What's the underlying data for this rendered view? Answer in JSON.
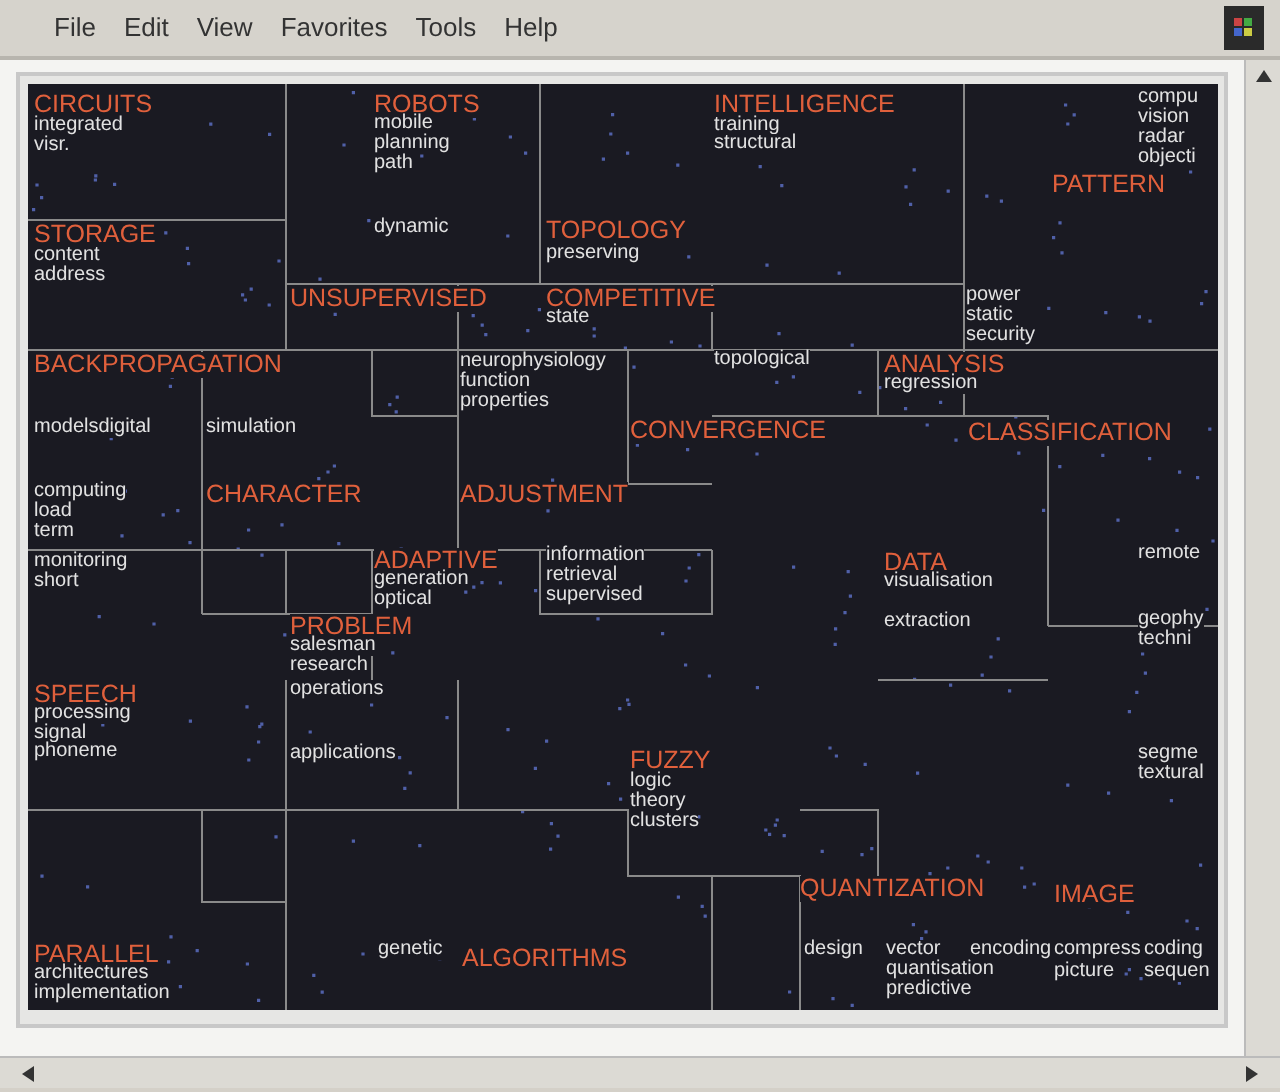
{
  "menu": [
    "File",
    "Edit",
    "View",
    "Favorites",
    "Tools",
    "Help"
  ],
  "map": {
    "labels": [
      {
        "text": "CIRCUITS",
        "kind": "topic"
      },
      {
        "text": "integrated",
        "kind": "word"
      },
      {
        "text": "visr.",
        "kind": "word"
      },
      {
        "text": "ROBOTS",
        "kind": "topic"
      },
      {
        "text": "mobile",
        "kind": "word"
      },
      {
        "text": "planning",
        "kind": "word"
      },
      {
        "text": "path",
        "kind": "word"
      },
      {
        "text": "INTELLIGENCE",
        "kind": "topic"
      },
      {
        "text": "training",
        "kind": "word"
      },
      {
        "text": "structural",
        "kind": "word"
      },
      {
        "text": "compu",
        "kind": "word"
      },
      {
        "text": "vision",
        "kind": "word"
      },
      {
        "text": "radar",
        "kind": "word"
      },
      {
        "text": "objecti",
        "kind": "word"
      },
      {
        "text": "PATTERN",
        "kind": "topic"
      },
      {
        "text": "STORAGE",
        "kind": "topic"
      },
      {
        "text": "content",
        "kind": "word"
      },
      {
        "text": "address",
        "kind": "word"
      },
      {
        "text": "dynamic",
        "kind": "word"
      },
      {
        "text": "TOPOLOGY",
        "kind": "topic"
      },
      {
        "text": "preserving",
        "kind": "word"
      },
      {
        "text": "UNSUPERVISED",
        "kind": "topic"
      },
      {
        "text": "COMPETITIVE",
        "kind": "topic"
      },
      {
        "text": "state",
        "kind": "word"
      },
      {
        "text": "power",
        "kind": "word"
      },
      {
        "text": "static",
        "kind": "word"
      },
      {
        "text": "security",
        "kind": "word"
      },
      {
        "text": "BACKPROPAGATION",
        "kind": "topic"
      },
      {
        "text": "neurophysiology",
        "kind": "word"
      },
      {
        "text": "function",
        "kind": "word"
      },
      {
        "text": "properties",
        "kind": "word"
      },
      {
        "text": "topological",
        "kind": "word"
      },
      {
        "text": "ANALYSIS",
        "kind": "topic"
      },
      {
        "text": "regression",
        "kind": "word"
      },
      {
        "text": "modelsdigital",
        "kind": "word"
      },
      {
        "text": "simulation",
        "kind": "word"
      },
      {
        "text": "CONVERGENCE",
        "kind": "topic"
      },
      {
        "text": "CLASSIFICATION",
        "kind": "topic"
      },
      {
        "text": "computing",
        "kind": "word"
      },
      {
        "text": "load",
        "kind": "word"
      },
      {
        "text": "term",
        "kind": "word"
      },
      {
        "text": "CHARACTER",
        "kind": "topic"
      },
      {
        "text": "ADJUSTMENT",
        "kind": "topic"
      },
      {
        "text": "remote",
        "kind": "word"
      },
      {
        "text": "monitoring",
        "kind": "word"
      },
      {
        "text": "short",
        "kind": "word"
      },
      {
        "text": "ADAPTIVE",
        "kind": "topic"
      },
      {
        "text": "generation",
        "kind": "word"
      },
      {
        "text": "optical",
        "kind": "word"
      },
      {
        "text": "information",
        "kind": "word"
      },
      {
        "text": "retrieval",
        "kind": "word"
      },
      {
        "text": "supervised",
        "kind": "word"
      },
      {
        "text": "DATA",
        "kind": "topic"
      },
      {
        "text": "visualisation",
        "kind": "word"
      },
      {
        "text": "extraction",
        "kind": "word"
      },
      {
        "text": "geophy",
        "kind": "word"
      },
      {
        "text": "techni",
        "kind": "word"
      },
      {
        "text": "PROBLEM",
        "kind": "topic"
      },
      {
        "text": "salesman",
        "kind": "word"
      },
      {
        "text": "research",
        "kind": "word"
      },
      {
        "text": "operations",
        "kind": "word"
      },
      {
        "text": "SPEECH",
        "kind": "topic"
      },
      {
        "text": "processing",
        "kind": "word"
      },
      {
        "text": "signal",
        "kind": "word"
      },
      {
        "text": "phoneme",
        "kind": "word"
      },
      {
        "text": "applications",
        "kind": "word"
      },
      {
        "text": "segme",
        "kind": "word"
      },
      {
        "text": "textural",
        "kind": "word"
      },
      {
        "text": "FUZZY",
        "kind": "topic"
      },
      {
        "text": "logic",
        "kind": "word"
      },
      {
        "text": "theory",
        "kind": "word"
      },
      {
        "text": "clusters",
        "kind": "word"
      },
      {
        "text": "QUANTIZATION",
        "kind": "topic"
      },
      {
        "text": "IMAGE",
        "kind": "topic"
      },
      {
        "text": "PARALLEL",
        "kind": "topic"
      },
      {
        "text": "architectures",
        "kind": "word"
      },
      {
        "text": "implementation",
        "kind": "word"
      },
      {
        "text": "genetic",
        "kind": "word"
      },
      {
        "text": "ALGORITHMS",
        "kind": "topic"
      },
      {
        "text": "design",
        "kind": "word"
      },
      {
        "text": "vector",
        "kind": "word"
      },
      {
        "text": "quantisation",
        "kind": "word"
      },
      {
        "text": "predictive",
        "kind": "word"
      },
      {
        "text": "encoding",
        "kind": "word"
      },
      {
        "text": "compress",
        "kind": "word"
      },
      {
        "text": "coding",
        "kind": "word"
      },
      {
        "text": "picture",
        "kind": "word"
      },
      {
        "text": "sequen",
        "kind": "word"
      }
    ]
  }
}
